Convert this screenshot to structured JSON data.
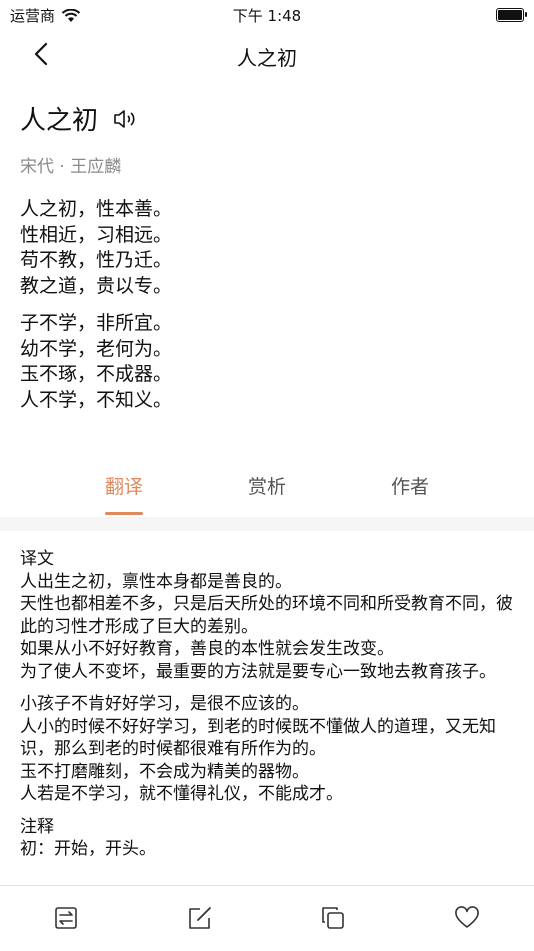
{
  "status": {
    "carrier": "运营商",
    "time": "下午 1:48",
    "battery_level": 1.0
  },
  "nav": {
    "title": "人之初"
  },
  "poem": {
    "title": "人之初",
    "author": "宋代 · 王应麟",
    "stanzas": [
      [
        "人之初，性本善。",
        "性相近，习相远。",
        "苟不教，性乃迁。",
        "教之道，贵以专。"
      ],
      [
        "子不学，非所宜。",
        "幼不学，老何为。",
        "玉不琢，不成器。",
        "人不学，不知义。"
      ]
    ]
  },
  "tabs": [
    {
      "label": "翻译",
      "active": true
    },
    {
      "label": "赏析",
      "active": false
    },
    {
      "label": "作者",
      "active": false
    }
  ],
  "translation": {
    "paragraphs": [
      [
        "译文",
        "人出生之初，禀性本身都是善良的。",
        "天性也都相差不多，只是后天所处的环境不同和所受教育不同，彼此的习性才形成了巨大的差别。",
        "如果从小不好好教育，善良的本性就会发生改变。",
        "为了使人不变坏，最重要的方法就是要专心一致地去教育孩子。"
      ],
      [
        "小孩子不肯好好学习，是很不应该的。",
        "人小的时候不好好学习，到老的时候既不懂做人的道理，又无知识，那么到老的时候都很难有所作为的。",
        "玉不打磨雕刻，不会成为精美的器物。",
        "人若是不学习，就不懂得礼仪，不能成才。"
      ],
      [
        "注释",
        "初：开始，开头。"
      ]
    ]
  },
  "colors": {
    "accent": "#e08a5c",
    "muted": "#8a8a8a"
  },
  "bottom_bar": {
    "icons": [
      "swap-icon",
      "edit-icon",
      "copy-icon",
      "heart-icon"
    ]
  }
}
